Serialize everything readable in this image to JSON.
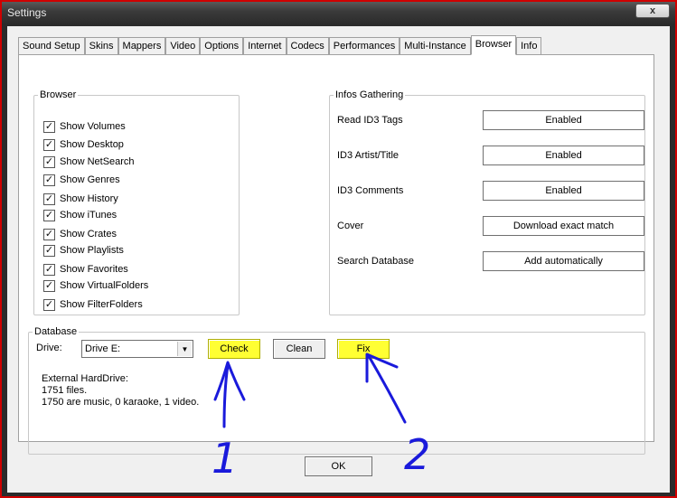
{
  "window": {
    "title": "Settings",
    "close_glyph": "x"
  },
  "tabs": [
    {
      "label": "Sound Setup",
      "active": false
    },
    {
      "label": "Skins",
      "active": false
    },
    {
      "label": "Mappers",
      "active": false
    },
    {
      "label": "Video",
      "active": false
    },
    {
      "label": "Options",
      "active": false
    },
    {
      "label": "Internet",
      "active": false
    },
    {
      "label": "Codecs",
      "active": false
    },
    {
      "label": "Performances",
      "active": false
    },
    {
      "label": "Multi-Instance",
      "active": false
    },
    {
      "label": "Browser",
      "active": true
    },
    {
      "label": "Info",
      "active": false
    }
  ],
  "browser": {
    "legend": "Browser",
    "items": [
      {
        "label": "Show Volumes",
        "checked": true
      },
      {
        "label": "Show Desktop",
        "checked": true
      },
      {
        "label": "Show NetSearch",
        "checked": true
      },
      {
        "label": "Show Genres",
        "checked": true
      },
      {
        "label": "Show History",
        "checked": true
      },
      {
        "label": "Show iTunes",
        "checked": true
      },
      {
        "label": "Show Crates",
        "checked": true
      },
      {
        "label": "Show Playlists",
        "checked": true
      },
      {
        "label": "Show Favorites",
        "checked": true
      },
      {
        "label": "Show VirtualFolders",
        "checked": true
      },
      {
        "label": "Show FilterFolders",
        "checked": true
      }
    ]
  },
  "infos": {
    "legend": "Infos Gathering",
    "rows": [
      {
        "label": "Read ID3 Tags",
        "value": "Enabled"
      },
      {
        "label": "ID3 Artist/Title",
        "value": "Enabled"
      },
      {
        "label": "ID3 Comments",
        "value": "Enabled"
      },
      {
        "label": "Cover",
        "value": "Download exact match"
      },
      {
        "label": "Search Database",
        "value": "Add automatically"
      }
    ]
  },
  "database": {
    "legend": "Database",
    "drive_label": "Drive:",
    "drive_value": "Drive E:",
    "check_label": "Check",
    "clean_label": "Clean",
    "fix_label": "Fix",
    "info_line1": "External HardDrive:",
    "info_line2": "1751 files.",
    "info_line3": "1750 are music, 0 karaoke, 1 video."
  },
  "ok_label": "OK",
  "annotations": {
    "marker1": "1",
    "marker2": "2",
    "highlight_color": "#ffff33",
    "ink_color": "#1a1adb"
  }
}
